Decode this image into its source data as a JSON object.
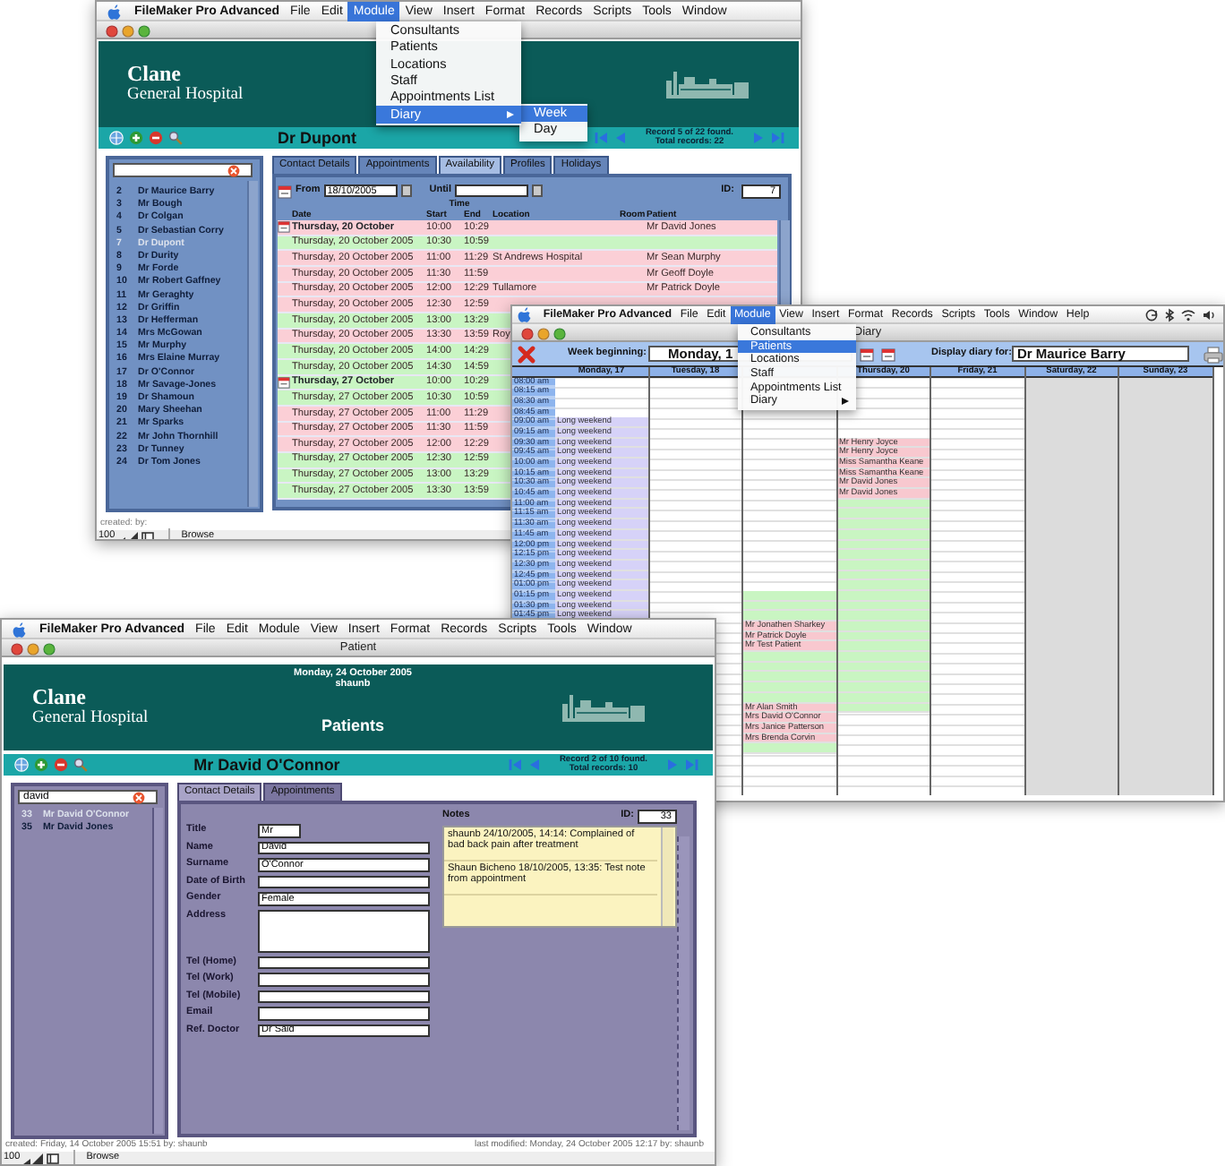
{
  "consultant_window": {
    "menu_bar": [
      {
        "label": "FileMaker Pro Advanced",
        "selected": false
      },
      {
        "label": "File",
        "selected": false
      },
      {
        "label": "Edit",
        "selected": false
      },
      {
        "label": "Module",
        "selected": true
      },
      {
        "label": "View",
        "selected": false
      },
      {
        "label": "Insert",
        "selected": false
      },
      {
        "label": "Format",
        "selected": false
      },
      {
        "label": "Records",
        "selected": false
      },
      {
        "label": "Scripts",
        "selected": false
      },
      {
        "label": "Tools",
        "selected": false
      },
      {
        "label": "Window",
        "selected": false
      }
    ],
    "open_menu": [
      {
        "label": "Consultants",
        "selected": false
      },
      {
        "label": "Patients",
        "selected": false
      },
      {
        "label": "Locations",
        "selected": false
      },
      {
        "label": "Staff",
        "selected": false
      },
      {
        "label": "Appointments List",
        "selected": false
      },
      {
        "label": "Diary",
        "selected": true,
        "submenu": true,
        "children": [
          {
            "label": "Week",
            "selected": true
          },
          {
            "label": "Day",
            "selected": false
          }
        ]
      }
    ],
    "header": {
      "name": "Clane",
      "subtitle": "General Hospital"
    },
    "record_title": "Dr Dupont",
    "record_status": [
      "Record 5 of 22 found.",
      "Total records: 22"
    ],
    "list": {
      "items": [
        {
          "number": "2",
          "name": "Dr Maurice Barry",
          "selected": false
        },
        {
          "number": "3",
          "name": "Mr Bough",
          "selected": false
        },
        {
          "number": "4",
          "name": "Dr Colgan",
          "selected": false
        },
        {
          "number": "5",
          "name": "Dr Sebastian Corry",
          "selected": false
        },
        {
          "number": "7",
          "name": "Dr Dupont",
          "selected": true
        },
        {
          "number": "8",
          "name": "Dr Durity",
          "selected": false
        },
        {
          "number": "9",
          "name": "Mr Forde",
          "selected": false
        },
        {
          "number": "10",
          "name": "Mr Robert Gaffney",
          "selected": false
        },
        {
          "number": "11",
          "name": "Mr Geraghty",
          "selected": false
        },
        {
          "number": "12",
          "name": "Dr Griffin",
          "selected": false
        },
        {
          "number": "13",
          "name": "Dr Hefferman",
          "selected": false
        },
        {
          "number": "14",
          "name": "Mrs McGowan",
          "selected": false
        },
        {
          "number": "15",
          "name": "Mr Murphy",
          "selected": false
        },
        {
          "number": "16",
          "name": "Mrs Elaine Murray",
          "selected": false
        },
        {
          "number": "17",
          "name": "Dr O'Connor",
          "selected": false
        },
        {
          "number": "18",
          "name": "Mr Savage-Jones",
          "selected": false
        },
        {
          "number": "19",
          "name": "Dr Shamoun",
          "selected": false
        },
        {
          "number": "20",
          "name": "Mary Sheehan",
          "selected": false
        },
        {
          "number": "21",
          "name": "Mr Sparks",
          "selected": false
        },
        {
          "number": "22",
          "name": "Mr John Thornhill",
          "selected": false
        },
        {
          "number": "23",
          "name": "Dr Tunney",
          "selected": false
        },
        {
          "number": "24",
          "name": "Dr Tom Jones",
          "selected": false
        }
      ]
    },
    "tabs": [
      {
        "label": "Contact Details",
        "selected": false
      },
      {
        "label": "Appointments",
        "selected": false
      },
      {
        "label": "Availability",
        "selected": true
      },
      {
        "label": "Profiles",
        "selected": false
      },
      {
        "label": "Holidays",
        "selected": false
      }
    ],
    "availability": {
      "from_label": "From",
      "from": "18/10/2005",
      "until_label": "Until",
      "id_label": "ID:",
      "id": "7",
      "columns": {
        "time": "Time",
        "date": "Date",
        "start": "Start",
        "end": "End",
        "location": "Location",
        "room": "Room",
        "patient": "Patient"
      },
      "rows": [
        {
          "kind": "day",
          "date": "Thursday, 20 October",
          "start": "10:00",
          "end": "10:29",
          "patient": "Mr David Jones",
          "booked": true
        },
        {
          "kind": "slot",
          "date": "Thursday, 20 October 2005",
          "start": "10:30",
          "end": "10:59",
          "booked": false
        },
        {
          "kind": "slot",
          "date": "Thursday, 20 October 2005",
          "start": "11:00",
          "end": "11:29",
          "location": "St Andrews Hospital",
          "patient": "Mr Sean Murphy",
          "booked": true
        },
        {
          "kind": "slot",
          "date": "Thursday, 20 October 2005",
          "start": "11:30",
          "end": "11:59",
          "patient": "Mr Geoff Doyle",
          "booked": true
        },
        {
          "kind": "slot",
          "date": "Thursday, 20 October 2005",
          "start": "12:00",
          "end": "12:29",
          "location": "Tullamore",
          "patient": "Mr Patrick Doyle",
          "booked": true
        },
        {
          "kind": "slot",
          "date": "Thursday, 20 October 2005",
          "start": "12:30",
          "end": "12:59",
          "booked": true
        },
        {
          "kind": "slot",
          "date": "Thursday, 20 October 2005",
          "start": "13:00",
          "end": "13:29",
          "booked": false
        },
        {
          "kind": "slot",
          "date": "Thursday, 20 October 2005",
          "start": "13:30",
          "end": "13:59",
          "location": "Roy",
          "booked": true
        },
        {
          "kind": "slot",
          "date": "Thursday, 20 October 2005",
          "start": "14:00",
          "end": "14:29",
          "booked": false
        },
        {
          "kind": "slot",
          "date": "Thursday, 20 October 2005",
          "start": "14:30",
          "end": "14:59",
          "booked": false
        },
        {
          "kind": "day",
          "date": "Thursday, 27 October",
          "start": "10:00",
          "end": "10:29",
          "booked": false
        },
        {
          "kind": "slot",
          "date": "Thursday, 27 October 2005",
          "start": "10:30",
          "end": "10:59",
          "booked": false
        },
        {
          "kind": "slot",
          "date": "Thursday, 27 October 2005",
          "start": "11:00",
          "end": "11:29",
          "booked": true
        },
        {
          "kind": "slot",
          "date": "Thursday, 27 October 2005",
          "start": "11:30",
          "end": "11:59",
          "booked": true
        },
        {
          "kind": "slot",
          "date": "Thursday, 27 October 2005",
          "start": "12:00",
          "end": "12:29",
          "booked": true
        },
        {
          "kind": "slot",
          "date": "Thursday, 27 October 2005",
          "start": "12:30",
          "end": "12:59",
          "booked": false
        },
        {
          "kind": "slot",
          "date": "Thursday, 27 October 2005",
          "start": "13:00",
          "end": "13:29",
          "booked": false
        },
        {
          "kind": "slot",
          "date": "Thursday, 27 October 2005",
          "start": "13:30",
          "end": "13:59",
          "booked": false
        }
      ]
    },
    "footer": {
      "created": "created: by:",
      "zoom": "100",
      "mode": "Browse"
    }
  },
  "diary_window": {
    "menu_bar": [
      {
        "label": "FileMaker Pro Advanced",
        "selected": false
      },
      {
        "label": "File",
        "selected": false
      },
      {
        "label": "Edit",
        "selected": false
      },
      {
        "label": "Module",
        "selected": true
      },
      {
        "label": "View",
        "selected": false
      },
      {
        "label": "Insert",
        "selected": false
      },
      {
        "label": "Format",
        "selected": false
      },
      {
        "label": "Records",
        "selected": false
      },
      {
        "label": "Scripts",
        "selected": false
      },
      {
        "label": "Tools",
        "selected": false
      },
      {
        "label": "Window",
        "selected": false
      },
      {
        "label": "Help",
        "selected": false
      }
    ],
    "open_menu": [
      {
        "label": "Consultants",
        "selected": false
      },
      {
        "label": "Patients",
        "selected": true
      },
      {
        "label": "Locations",
        "selected": false
      },
      {
        "label": "Staff",
        "selected": false
      },
      {
        "label": "Appointments List",
        "selected": false
      },
      {
        "label": "Diary",
        "selected": false,
        "submenu": true
      }
    ],
    "title": "Diary",
    "week_label": "Week beginning:",
    "week_value": "Monday, 1",
    "diary_for_label": "Display diary for:",
    "diary_for": "Dr Maurice Barry",
    "times": [
      "08:00 am",
      "08:15 am",
      "08:30 am",
      "08:45 am",
      "09:00 am",
      "09:15 am",
      "09:30 am",
      "09:45 am",
      "10:00 am",
      "10:15 am",
      "10:30 am",
      "10:45 am",
      "11:00 am",
      "11:15 am",
      "11:30 am",
      "11:45 am",
      "12:00 pm",
      "12:15 pm",
      "12:30 pm",
      "12:45 pm",
      "01:00 pm",
      "01:15 pm",
      "01:30 pm",
      "01:45 pm"
    ],
    "days": [
      {
        "label": "Monday, 17",
        "weekend": false,
        "slots": [
          {
            "kind": "empty"
          },
          {
            "kind": "empty"
          },
          {
            "kind": "empty"
          },
          {
            "kind": "empty"
          },
          {
            "kind": "holiday",
            "text": "Long weekend"
          },
          {
            "kind": "holiday",
            "text": "Long weekend"
          },
          {
            "kind": "holiday",
            "text": "Long weekend"
          },
          {
            "kind": "holiday",
            "text": "Long weekend"
          },
          {
            "kind": "holiday",
            "text": "Long weekend"
          },
          {
            "kind": "holiday",
            "text": "Long weekend"
          },
          {
            "kind": "holiday",
            "text": "Long weekend"
          },
          {
            "kind": "holiday",
            "text": "Long weekend"
          },
          {
            "kind": "holiday",
            "text": "Long weekend"
          },
          {
            "kind": "holiday",
            "text": "Long weekend"
          },
          {
            "kind": "holiday",
            "text": "Long weekend"
          },
          {
            "kind": "holiday",
            "text": "Long weekend"
          },
          {
            "kind": "holiday",
            "text": "Long weekend"
          },
          {
            "kind": "holiday",
            "text": "Long weekend"
          },
          {
            "kind": "holiday",
            "text": "Long weekend"
          },
          {
            "kind": "holiday",
            "text": "Long weekend"
          },
          {
            "kind": "holiday",
            "text": "Long weekend"
          },
          {
            "kind": "holiday",
            "text": "Long weekend"
          },
          {
            "kind": "holiday",
            "text": "Long weekend"
          },
          {
            "kind": "holiday",
            "text": "Long weekend"
          }
        ]
      },
      {
        "label": "Tuesday, 18",
        "weekend": false
      },
      {
        "weekend": false,
        "slots": [
          {
            "kind": "empty"
          },
          {
            "kind": "empty"
          },
          {
            "kind": "empty"
          },
          {
            "kind": "empty"
          },
          {
            "kind": "empty"
          },
          {
            "kind": "empty"
          },
          {
            "kind": "empty"
          },
          {
            "kind": "empty"
          },
          {
            "kind": "empty"
          },
          {
            "kind": "empty"
          },
          {
            "kind": "empty"
          },
          {
            "kind": "empty"
          },
          {
            "kind": "empty"
          },
          {
            "kind": "empty"
          },
          {
            "kind": "empty"
          },
          {
            "kind": "empty"
          },
          {
            "kind": "empty"
          },
          {
            "kind": "empty"
          },
          {
            "kind": "empty"
          },
          {
            "kind": "empty"
          },
          {
            "kind": "empty"
          },
          {
            "kind": "free"
          },
          {
            "kind": "free"
          },
          {
            "kind": "free"
          },
          {
            "kind": "booked",
            "text": "Mr Jonathen Sharkey"
          },
          {
            "kind": "booked",
            "text": "Mr Patrick Doyle"
          },
          {
            "kind": "booked",
            "text": "Mr Test Patient"
          },
          {
            "kind": "free"
          },
          {
            "kind": "free"
          },
          {
            "kind": "free"
          },
          {
            "kind": "free"
          },
          {
            "kind": "free"
          },
          {
            "kind": "booked",
            "text": "Mr Alan Smith"
          },
          {
            "kind": "booked",
            "text": "Mrs David O'Connor"
          },
          {
            "kind": "booked",
            "text": "Mrs Janice Patterson"
          },
          {
            "kind": "booked",
            "text": "Mrs Brenda Corvin"
          },
          {
            "kind": "free"
          }
        ]
      },
      {
        "label": "Thursday, 20",
        "weekend": false,
        "slots": [
          {
            "kind": "empty"
          },
          {
            "kind": "empty"
          },
          {
            "kind": "empty"
          },
          {
            "kind": "empty"
          },
          {
            "kind": "empty"
          },
          {
            "kind": "empty"
          },
          {
            "kind": "booked",
            "text": "Mr Henry Joyce"
          },
          {
            "kind": "booked",
            "text": "Mr Henry Joyce"
          },
          {
            "kind": "booked",
            "text": "Miss Samantha Keane"
          },
          {
            "kind": "booked",
            "text": "Miss Samantha Keane"
          },
          {
            "kind": "booked",
            "text": "Mr David Jones"
          },
          {
            "kind": "booked",
            "text": "Mr David Jones"
          },
          {
            "kind": "free"
          },
          {
            "kind": "free"
          },
          {
            "kind": "free"
          },
          {
            "kind": "free"
          },
          {
            "kind": "free"
          },
          {
            "kind": "free"
          },
          {
            "kind": "free"
          },
          {
            "kind": "free"
          },
          {
            "kind": "free"
          },
          {
            "kind": "free"
          },
          {
            "kind": "free"
          },
          {
            "kind": "free"
          },
          {
            "kind": "free"
          },
          {
            "kind": "free"
          },
          {
            "kind": "free"
          },
          {
            "kind": "free"
          },
          {
            "kind": "free"
          },
          {
            "kind": "free"
          },
          {
            "kind": "free"
          },
          {
            "kind": "free"
          },
          {
            "kind": "free"
          }
        ]
      },
      {
        "label": "Friday, 21",
        "weekend": false
      },
      {
        "label": "Saturday, 22",
        "weekend": true
      },
      {
        "label": "Sunday, 23",
        "weekend": true
      }
    ]
  },
  "patient_window": {
    "menu_bar": [
      {
        "label": "FileMaker Pro Advanced",
        "selected": false
      },
      {
        "label": "File",
        "selected": false
      },
      {
        "label": "Edit",
        "selected": false
      },
      {
        "label": "Module",
        "selected": false
      },
      {
        "label": "View",
        "selected": false
      },
      {
        "label": "Insert",
        "selected": false
      },
      {
        "label": "Format",
        "selected": false
      },
      {
        "label": "Records",
        "selected": false
      },
      {
        "label": "Scripts",
        "selected": false
      },
      {
        "label": "Tools",
        "selected": false
      },
      {
        "label": "Window",
        "selected": false
      }
    ],
    "title": "Patient",
    "header": {
      "name": "Clane",
      "subtitle": "General Hospital",
      "date": "Monday, 24 October 2005",
      "user": "shaunb",
      "heading": "Patients"
    },
    "record_title": "Mr David O'Connor",
    "record_status": [
      "Record 2 of 10 found.",
      "Total records: 10"
    ],
    "list": {
      "search": "david",
      "items": [
        {
          "number": "33",
          "name": "Mr David O'Connor",
          "selected": true
        },
        {
          "number": "35",
          "name": "Mr David Jones",
          "selected": false
        }
      ]
    },
    "tabs": [
      {
        "label": "Contact Details",
        "selected": true
      },
      {
        "label": "Appointments",
        "selected": false
      }
    ],
    "fields": [
      {
        "label": "Title",
        "value": "Mr",
        "kind": "short"
      },
      {
        "label": "Name",
        "value": "David",
        "kind": "line"
      },
      {
        "label": "Surname",
        "value": "O'Connor",
        "kind": "line"
      },
      {
        "label": "Date of Birth",
        "kind": "line"
      },
      {
        "label": "Gender",
        "value": "Female",
        "kind": "line"
      },
      {
        "label": "Address",
        "kind": "area"
      },
      {
        "label": "Tel (Home)",
        "kind": "line"
      },
      {
        "label": "Tel (Work)",
        "kind": "line"
      },
      {
        "label": "Tel (Mobile)",
        "kind": "line"
      },
      {
        "label": "Email",
        "kind": "line"
      },
      {
        "label": "Ref. Doctor",
        "value": "Dr Said",
        "kind": "line"
      }
    ],
    "notes_label": "Notes",
    "id_label": "ID:",
    "id": "33",
    "notes": [
      "shaunb 24/10/2005, 14:14: Complained of bad back pain after treatment",
      "Shaun Bicheno 18/10/2005, 13:35: Test note from appointment"
    ],
    "footer": {
      "created": "created: Friday, 14 October 2005 15:51 by: shaunb",
      "modified": "last modified: Monday, 24 October 2005 12:17 by: shaunb",
      "zoom": "100",
      "mode": "Browse"
    }
  }
}
